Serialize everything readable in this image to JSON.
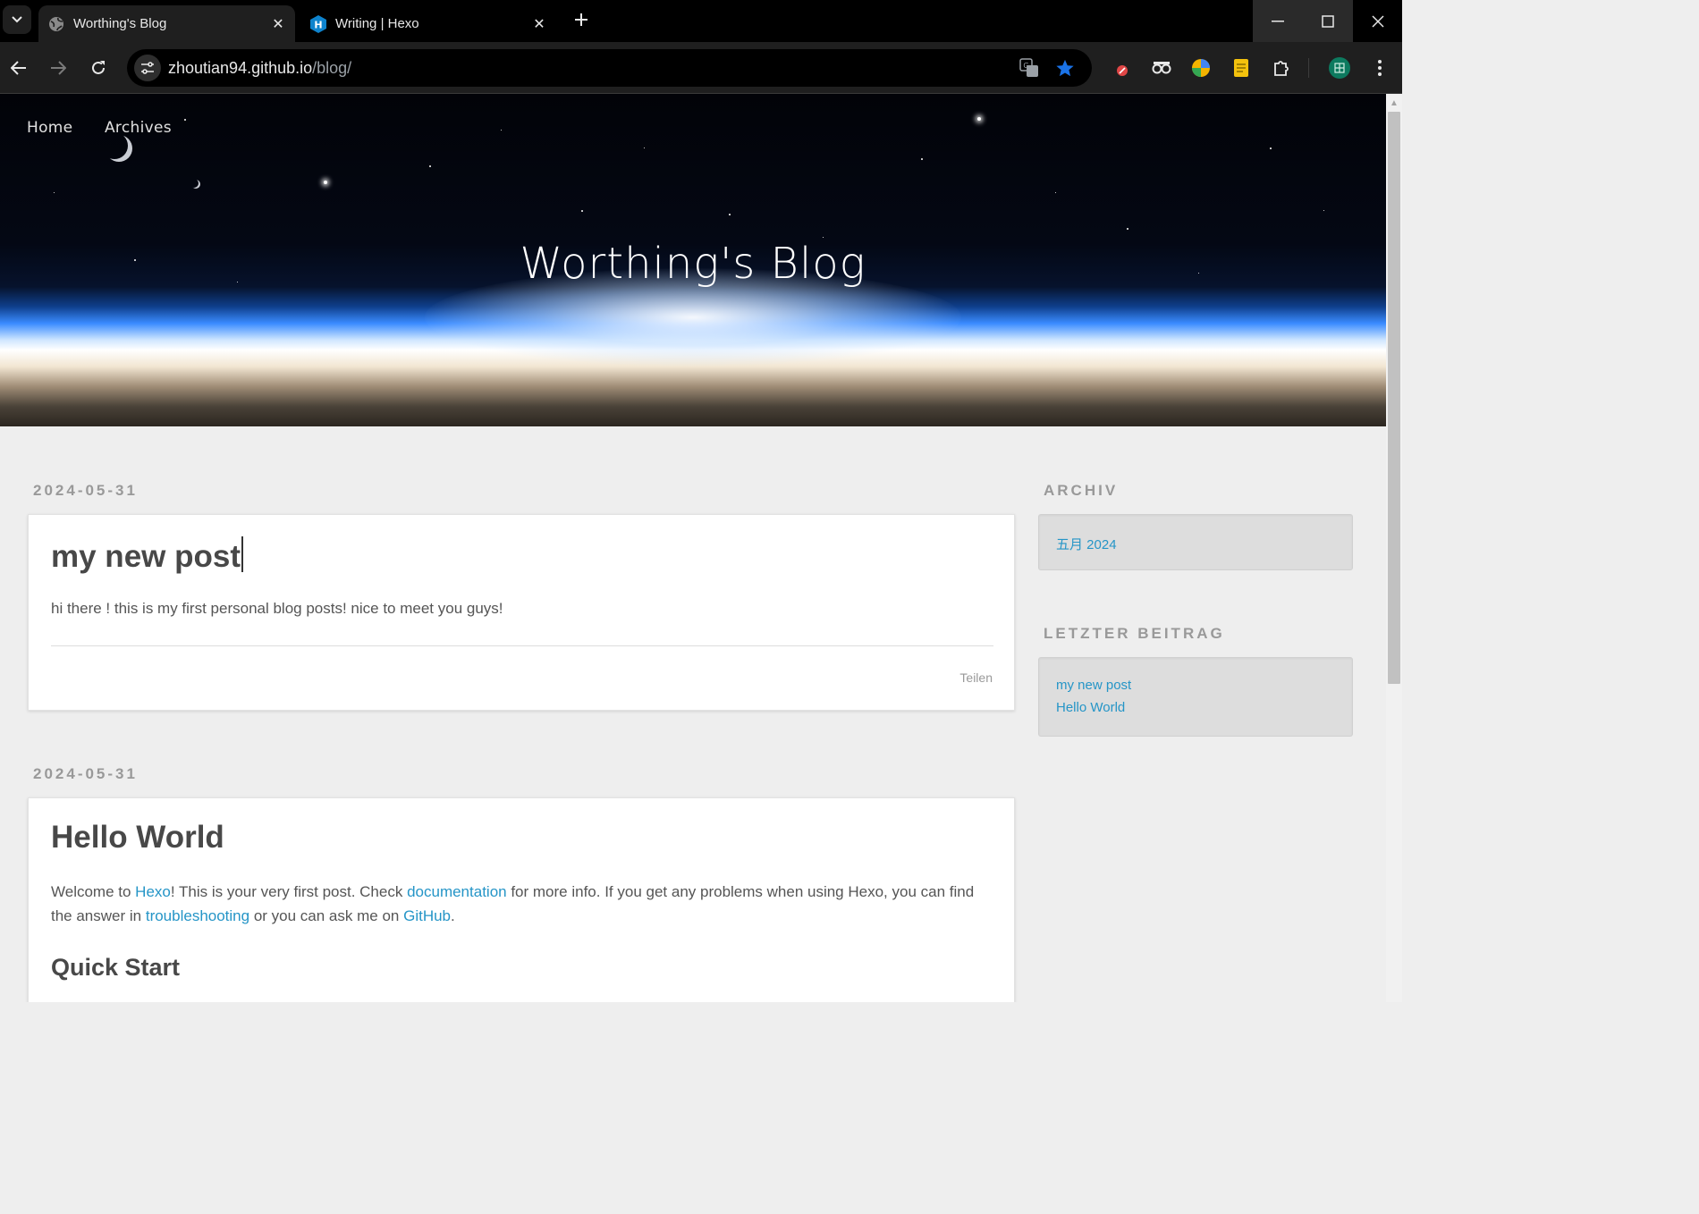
{
  "browser": {
    "tabs": [
      {
        "title": "Worthing's Blog",
        "active": true,
        "favicon": "globe-icon"
      },
      {
        "title": "Writing | Hexo",
        "active": false,
        "favicon": "hexo-icon"
      }
    ],
    "address": {
      "host": "zhoutian94.github.io",
      "path": "/blog/"
    },
    "accent_color": "#1a73e8"
  },
  "page": {
    "nav": {
      "home": "Home",
      "archives": "Archives"
    },
    "site_title": "Worthing's Blog",
    "posts": [
      {
        "date": "2024-05-31",
        "title": "my new post",
        "excerpt": "hi there ! this is my first personal blog posts! nice to meet you guys!",
        "share": "Teilen"
      },
      {
        "date": "2024-05-31",
        "title": "Hello World",
        "body": {
          "t1": "Welcome to ",
          "l1": "Hexo",
          "t2": "! This is your very first post. Check ",
          "l2": "documentation",
          "t3": " for more info. If you get any problems when using Hexo, you can find the answer in ",
          "l3": "troubleshooting",
          "t4": " or you can ask me on ",
          "l4": "GitHub",
          "t5": "."
        },
        "subheading": "Quick Start"
      }
    ],
    "sidebar": {
      "archive_title": "ARCHIV",
      "archive_items": [
        "五月 2024"
      ],
      "recent_title": "LETZTER BEITRAG",
      "recent_items": [
        "my new post",
        "Hello World"
      ]
    },
    "link_color": "#2595c7"
  }
}
